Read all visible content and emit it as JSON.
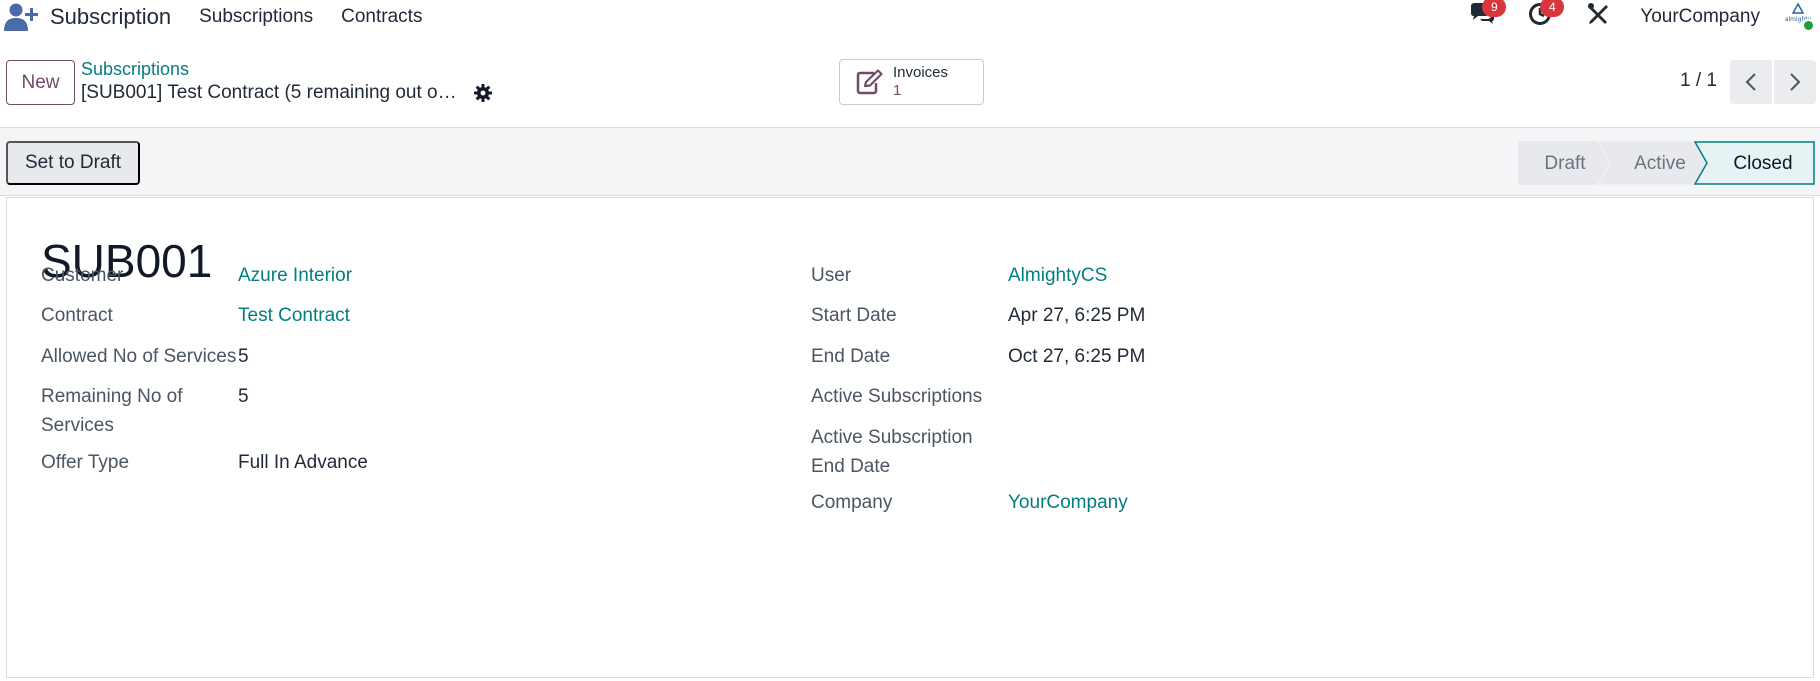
{
  "navbar": {
    "app_title": "Subscription",
    "menus": [
      "Subscriptions",
      "Contracts"
    ],
    "messages_count": "9",
    "activities_count": "4",
    "company": "YourCompany",
    "avatar_text": "almighty"
  },
  "control": {
    "new_label": "New",
    "breadcrumb_parent": "Subscriptions",
    "breadcrumb_current": "[SUB001] Test Contract (5 remaining out o…",
    "smart_button": {
      "label": "Invoices",
      "count": "1"
    },
    "pager": "1 / 1"
  },
  "statusbar": {
    "set_to_draft_label": "Set to Draft",
    "stages": [
      {
        "label": "Draft",
        "active": false
      },
      {
        "label": "Active",
        "active": false
      },
      {
        "label": "Closed",
        "active": true
      }
    ]
  },
  "record": {
    "name": "SUB001",
    "left_fields": [
      {
        "label": "Customer",
        "value": "Azure Interior",
        "link": true
      },
      {
        "label": "Contract",
        "value": "Test Contract",
        "link": true
      },
      {
        "label": "Allowed No of Services",
        "value": "5",
        "link": false
      },
      {
        "label": "Remaining No of Services",
        "value": "5",
        "link": false
      },
      {
        "label": "Offer Type",
        "value": "Full In Advance",
        "link": false
      }
    ],
    "right_fields": [
      {
        "label": "User",
        "value": "AlmightyCS",
        "link": true
      },
      {
        "label": "Start Date",
        "value": "Apr 27, 6:25 PM",
        "link": false
      },
      {
        "label": "End Date",
        "value": "Oct 27, 6:25 PM",
        "link": false
      },
      {
        "label": "Active Subscriptions",
        "value": "",
        "link": false
      },
      {
        "label": "Active Subscription End Date",
        "value": "",
        "link": false
      },
      {
        "label": "Company",
        "value": "YourCompany",
        "link": true
      }
    ]
  },
  "colors": {
    "brand": "#714b67",
    "link": "#017e84",
    "badge": "#d9363e",
    "online": "#1f9d37"
  }
}
